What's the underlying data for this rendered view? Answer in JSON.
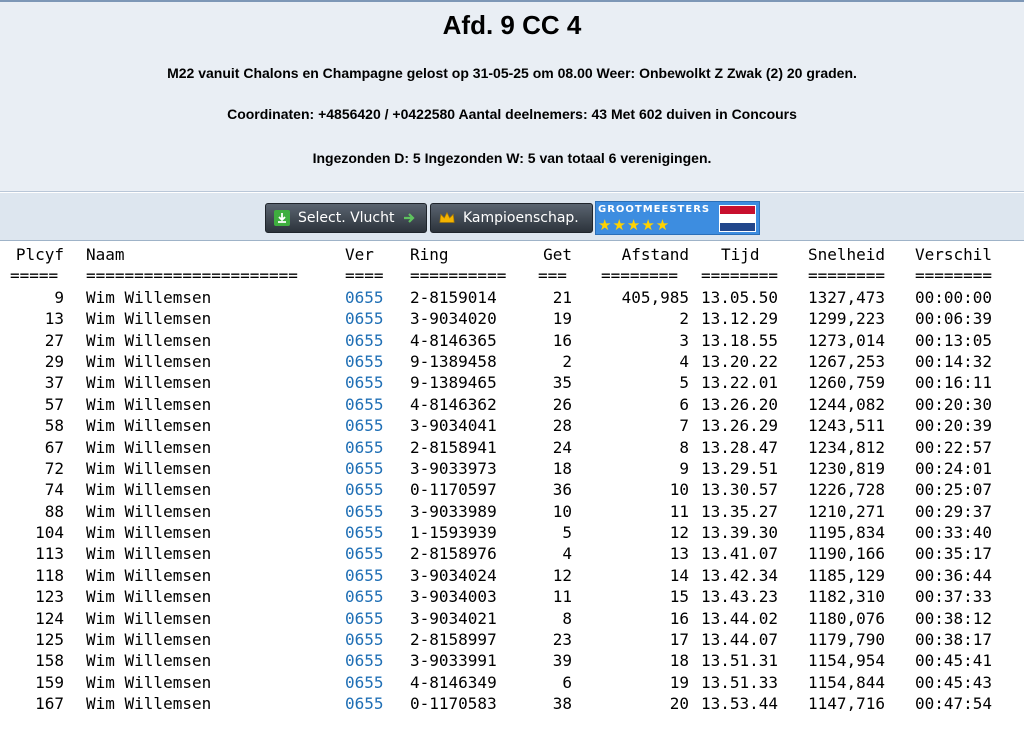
{
  "header": {
    "title": "Afd. 9 CC 4",
    "line1": "M22 vanuit Chalons en Champagne gelost op 31-05-25 om 08.00 Weer: Onbewolkt Z Zwak (2) 20 graden.",
    "line2": "Coordinaten: +4856420 / +0422580 Aantal deelnemers: 43 Met 602 duiven in Concours",
    "line3": "Ingezonden D: 5 Ingezonden W: 5 van totaal 6 verenigingen."
  },
  "toolbar": {
    "select_label": "Select. Vlucht",
    "kampioen_label": "Kampioenschap.",
    "grootmeesters_label": "GROOTMEESTERS",
    "stars": "★★★★★"
  },
  "table": {
    "headers": [
      "Plcyf",
      "Naam",
      "Ver",
      "Ring",
      "Get",
      "Afstand",
      "Tijd",
      "Snelheid",
      "Verschil"
    ],
    "separators": [
      "=====",
      "======================",
      "====",
      "==========",
      "===",
      "========",
      "========",
      "========",
      "========"
    ],
    "rows": [
      [
        "9",
        "Wim Willemsen",
        "0655",
        "2-8159014",
        "21",
        "405,985",
        "13.05.50",
        "1327,473",
        "00:00:00"
      ],
      [
        "13",
        "Wim Willemsen",
        "0655",
        "3-9034020",
        "19",
        "2",
        "13.12.29",
        "1299,223",
        "00:06:39"
      ],
      [
        "27",
        "Wim Willemsen",
        "0655",
        "4-8146365",
        "16",
        "3",
        "13.18.55",
        "1273,014",
        "00:13:05"
      ],
      [
        "29",
        "Wim Willemsen",
        "0655",
        "9-1389458",
        "2",
        "4",
        "13.20.22",
        "1267,253",
        "00:14:32"
      ],
      [
        "37",
        "Wim Willemsen",
        "0655",
        "9-1389465",
        "35",
        "5",
        "13.22.01",
        "1260,759",
        "00:16:11"
      ],
      [
        "57",
        "Wim Willemsen",
        "0655",
        "4-8146362",
        "26",
        "6",
        "13.26.20",
        "1244,082",
        "00:20:30"
      ],
      [
        "58",
        "Wim Willemsen",
        "0655",
        "3-9034041",
        "28",
        "7",
        "13.26.29",
        "1243,511",
        "00:20:39"
      ],
      [
        "67",
        "Wim Willemsen",
        "0655",
        "2-8158941",
        "24",
        "8",
        "13.28.47",
        "1234,812",
        "00:22:57"
      ],
      [
        "72",
        "Wim Willemsen",
        "0655",
        "3-9033973",
        "18",
        "9",
        "13.29.51",
        "1230,819",
        "00:24:01"
      ],
      [
        "74",
        "Wim Willemsen",
        "0655",
        "0-1170597",
        "36",
        "10",
        "13.30.57",
        "1226,728",
        "00:25:07"
      ],
      [
        "88",
        "Wim Willemsen",
        "0655",
        "3-9033989",
        "10",
        "11",
        "13.35.27",
        "1210,271",
        "00:29:37"
      ],
      [
        "104",
        "Wim Willemsen",
        "0655",
        "1-1593939",
        "5",
        "12",
        "13.39.30",
        "1195,834",
        "00:33:40"
      ],
      [
        "113",
        "Wim Willemsen",
        "0655",
        "2-8158976",
        "4",
        "13",
        "13.41.07",
        "1190,166",
        "00:35:17"
      ],
      [
        "118",
        "Wim Willemsen",
        "0655",
        "3-9034024",
        "12",
        "14",
        "13.42.34",
        "1185,129",
        "00:36:44"
      ],
      [
        "123",
        "Wim Willemsen",
        "0655",
        "3-9034003",
        "11",
        "15",
        "13.43.23",
        "1182,310",
        "00:37:33"
      ],
      [
        "124",
        "Wim Willemsen",
        "0655",
        "3-9034021",
        "8",
        "16",
        "13.44.02",
        "1180,076",
        "00:38:12"
      ],
      [
        "125",
        "Wim Willemsen",
        "0655",
        "2-8158997",
        "23",
        "17",
        "13.44.07",
        "1179,790",
        "00:38:17"
      ],
      [
        "158",
        "Wim Willemsen",
        "0655",
        "3-9033991",
        "39",
        "18",
        "13.51.31",
        "1154,954",
        "00:45:41"
      ],
      [
        "159",
        "Wim Willemsen",
        "0655",
        "4-8146349",
        "6",
        "19",
        "13.51.33",
        "1154,844",
        "00:45:43"
      ],
      [
        "167",
        "Wim Willemsen",
        "0655",
        "0-1170583",
        "38",
        "20",
        "13.53.44",
        "1147,716",
        "00:47:54"
      ]
    ]
  },
  "colors": {
    "header_bg": "#e9eef4",
    "toolbar_bg": "#dde6ef",
    "ver_link": "#1f6fb5",
    "flag_red": "#c8102e",
    "flag_white": "#ffffff",
    "flag_blue": "#21468b"
  }
}
